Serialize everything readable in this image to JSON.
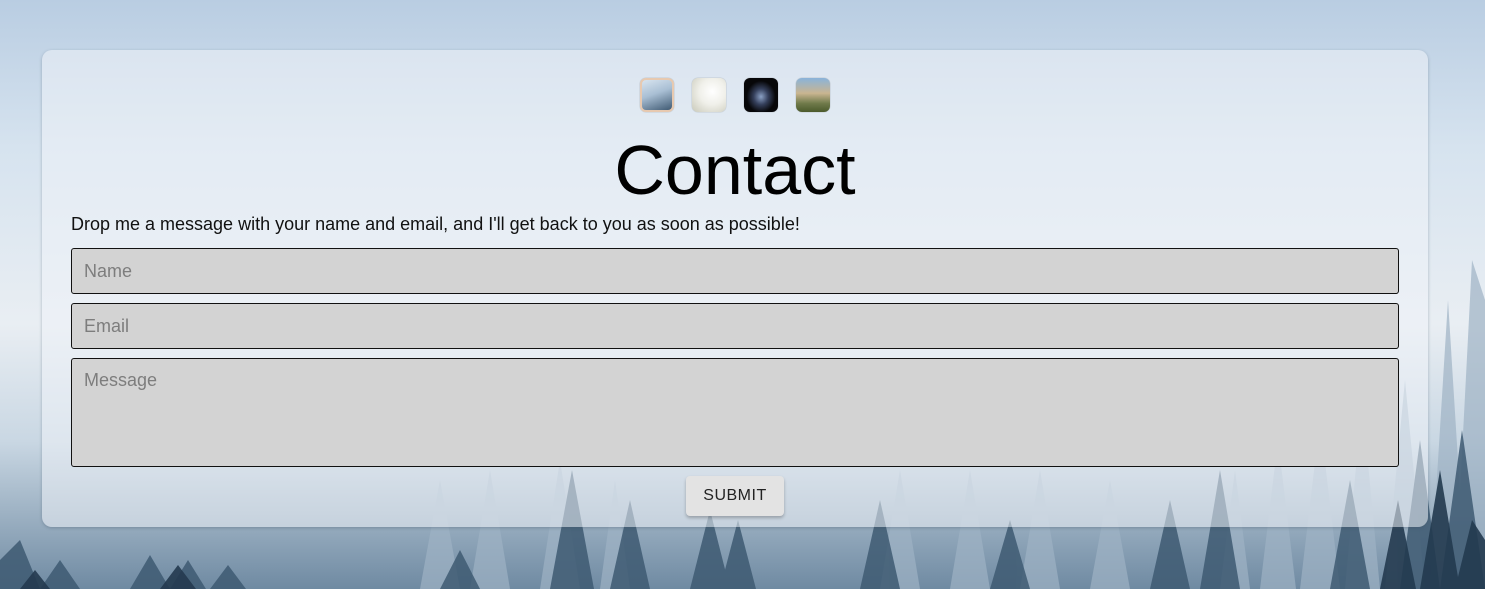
{
  "background": {
    "image": "misty-forest-background"
  },
  "gallery": {
    "thumbnails": [
      {
        "name": "misty-mountain-thumbnail"
      },
      {
        "name": "bright-white-thumbnail"
      },
      {
        "name": "dark-planet-thumbnail"
      },
      {
        "name": "landscape-thumbnail"
      }
    ]
  },
  "contact": {
    "title": "Contact",
    "description": "Drop me a message with your name and email, and I'll get back to you as soon as possible!",
    "name_placeholder": "Name",
    "email_placeholder": "Email",
    "message_placeholder": "Message",
    "submit_label": "SUBMIT"
  },
  "colors": {
    "field_background": "#d3d3d3",
    "button_background": "#e3e3e3",
    "text": "#000000"
  }
}
